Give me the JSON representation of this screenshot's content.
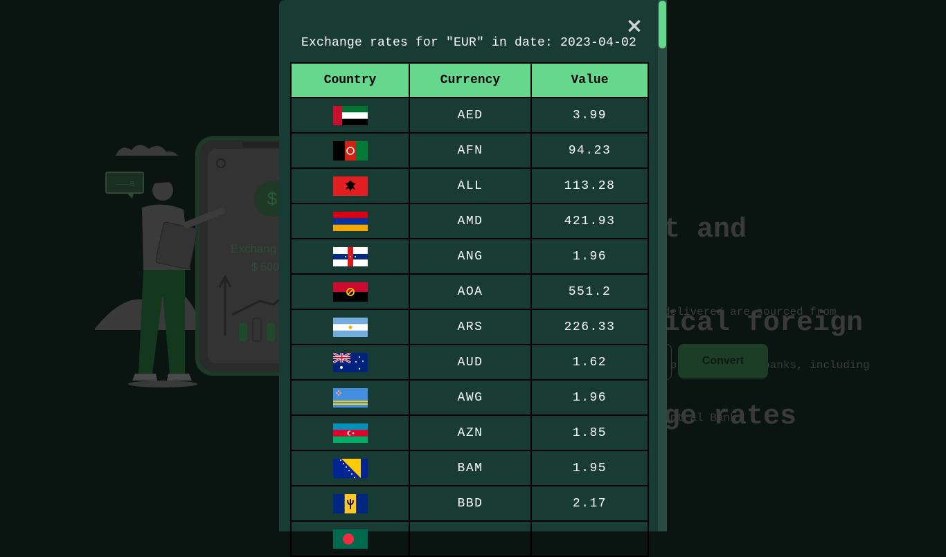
{
  "hero": {
    "heading_lines": [
      "t and",
      "ical foreign",
      "ge rates"
    ],
    "description_lines": [
      "delivered are sourced from",
      " providers and banks, including",
      "entral Bank."
    ],
    "illustration_caption_line1": "Exchang",
    "illustration_caption_line2": "$ 500",
    "convert_label": "Convert"
  },
  "modal": {
    "close_symbol": "×",
    "title": "Exchange rates for \"EUR\" in date: 2023-04-02",
    "columns": [
      "Country",
      "Currency",
      "Value"
    ],
    "rows": [
      {
        "flag": "ae-flag-icon",
        "currency": "AED",
        "value": "3.99"
      },
      {
        "flag": "af-flag-icon",
        "currency": "AFN",
        "value": "94.23"
      },
      {
        "flag": "al-flag-icon",
        "currency": "ALL",
        "value": "113.28"
      },
      {
        "flag": "am-flag-icon",
        "currency": "AMD",
        "value": "421.93"
      },
      {
        "flag": "an-flag-icon",
        "currency": "ANG",
        "value": "1.96"
      },
      {
        "flag": "ao-flag-icon",
        "currency": "AOA",
        "value": "551.2"
      },
      {
        "flag": "ar-flag-icon",
        "currency": "ARS",
        "value": "226.33"
      },
      {
        "flag": "au-flag-icon",
        "currency": "AUD",
        "value": "1.62"
      },
      {
        "flag": "aw-flag-icon",
        "currency": "AWG",
        "value": "1.96"
      },
      {
        "flag": "az-flag-icon",
        "currency": "AZN",
        "value": "1.85"
      },
      {
        "flag": "ba-flag-icon",
        "currency": "BAM",
        "value": "1.95"
      },
      {
        "flag": "bb-flag-icon",
        "currency": "BBD",
        "value": "2.17"
      },
      {
        "flag": "bd-flag-icon",
        "currency": "",
        "value": ""
      }
    ]
  },
  "colors": {
    "modal_bg": "#183c33",
    "header_bg": "#66d88d",
    "scroll_thumb": "#66d88d"
  }
}
